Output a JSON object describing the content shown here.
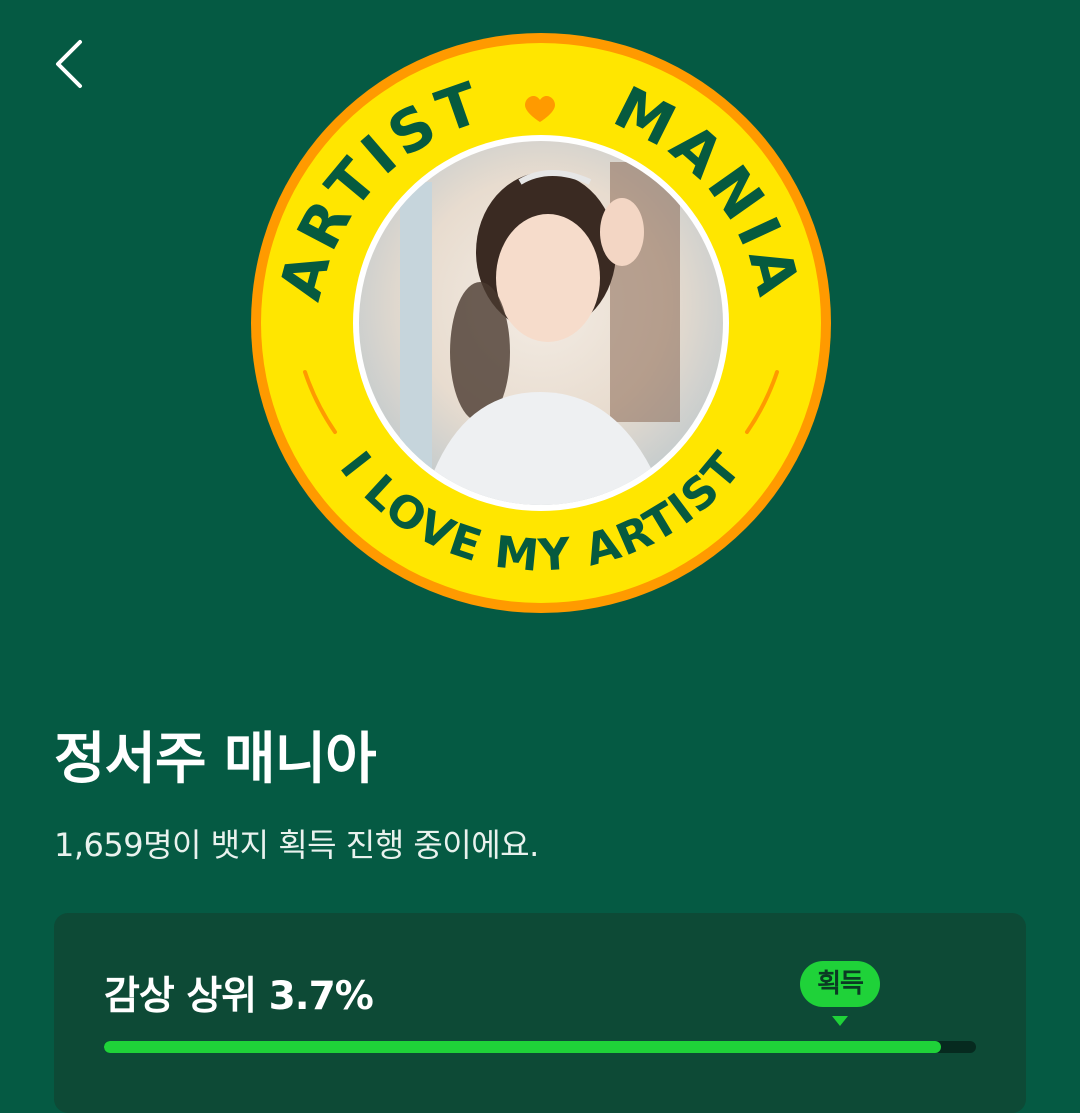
{
  "header": {
    "back_icon": "chevron-left-icon"
  },
  "badge": {
    "top_text": "ARTIST",
    "top_text_right": "MANIA",
    "bottom_text": "I LOVE MY ARTIST",
    "heart_icon": "heart-icon",
    "colors": {
      "ring_outer": "#ff9a00",
      "ring": "#ffe600",
      "text": "#065a3f",
      "heart": "#ff9a00"
    }
  },
  "title": "정서주 매니아",
  "subtitle": "1,659명이 뱃지 획득 진행 중이에요.",
  "stat": {
    "label": "감상 상위 3.7%",
    "acquired_label": "획득",
    "progress": 0.96,
    "colors": {
      "accent": "#1fd239",
      "card": "#0d4a36",
      "background": "#055a43"
    }
  }
}
